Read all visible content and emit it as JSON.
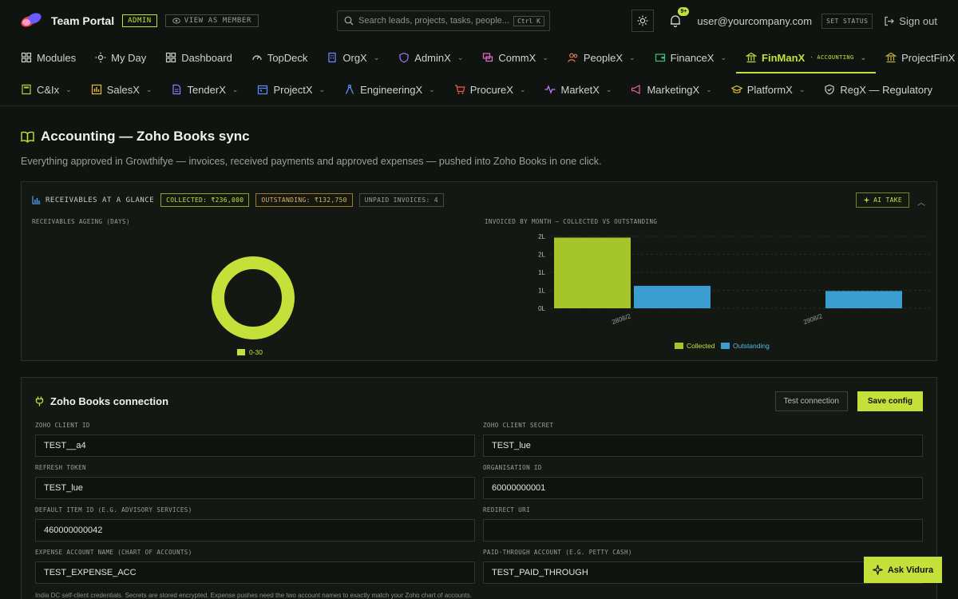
{
  "header": {
    "brand": "Team Portal",
    "admin_badge": "ADMIN",
    "view_as_member": "VIEW AS MEMBER",
    "search_placeholder": "Search leads, projects, tasks, people...",
    "search_shortcut": "Ctrl K",
    "notification_count": "9+",
    "user_email": "user@yourcompany.com",
    "set_status": "SET STATUS",
    "sign_out": "Sign out"
  },
  "nav_row1": [
    {
      "label": "Modules",
      "icon": "grid-icon"
    },
    {
      "label": "My Day",
      "icon": "sun-icon"
    },
    {
      "label": "Dashboard",
      "icon": "grid-icon"
    },
    {
      "label": "TopDeck",
      "icon": "gauge-icon"
    },
    {
      "label": "OrgX",
      "icon": "building-icon"
    },
    {
      "label": "AdminX",
      "icon": "shield-icon"
    },
    {
      "label": "CommX",
      "icon": "chat-icon"
    },
    {
      "label": "PeopleX",
      "icon": "people-icon"
    },
    {
      "label": "FinanceX",
      "icon": "wallet-icon"
    },
    {
      "label": "FinManX",
      "sub": "· ACCOUNTING",
      "icon": "bank-icon"
    },
    {
      "label": "ProjectFinX",
      "icon": "bank-icon"
    }
  ],
  "nav_row2": [
    {
      "label": "C&Ix",
      "icon": "calc-icon"
    },
    {
      "label": "SalesX",
      "icon": "sales-icon"
    },
    {
      "label": "TenderX",
      "icon": "document-icon"
    },
    {
      "label": "ProjectX",
      "icon": "calendar-icon"
    },
    {
      "label": "EngineeringX",
      "icon": "compass-icon"
    },
    {
      "label": "ProcureX",
      "icon": "cart-icon"
    },
    {
      "label": "MarketX",
      "icon": "pulse-icon"
    },
    {
      "label": "MarketingX",
      "icon": "megaphone-icon"
    },
    {
      "label": "PlatformX",
      "icon": "cap-icon"
    },
    {
      "label": "RegX — Regulatory",
      "icon": "shield-icon"
    }
  ],
  "page": {
    "title": "Accounting — Zoho Books sync",
    "subtitle": "Everything approved in Growthifye — invoices, received payments and approved expenses — pushed into Zoho Books in one click."
  },
  "receivables": {
    "title": "RECEIVABLES AT A GLANCE",
    "collected_chip": "COLLECTED: ₹236,000",
    "outstanding_chip": "OUTSTANDING: ₹132,750",
    "unpaid_chip": "UNPAID INVOICES: 4",
    "ai_take": "AI TAKE",
    "ageing_label": "RECEIVABLES AGEING (DAYS)",
    "monthly_label": "INVOICED BY MONTH — COLLECTED VS OUTSTANDING"
  },
  "chart_data": [
    {
      "type": "pie",
      "title": "RECEIVABLES AGEING (DAYS)",
      "slices": [
        {
          "name": "0-30",
          "value": 100,
          "color": "#c6e03a"
        }
      ],
      "legend": "bottom"
    },
    {
      "type": "bar",
      "title": "INVOICED BY MONTH — COLLECTED VS OUTSTANDING",
      "categories": [
        "2808/2",
        "2908/2"
      ],
      "series": [
        {
          "name": "Collected",
          "values": [
            236000,
            0
          ],
          "color": "#a6c52c"
        },
        {
          "name": "Outstanding",
          "values": [
            75000,
            57750
          ],
          "color": "#3a9fd0"
        }
      ],
      "y_ticks": [
        "0L",
        "1L",
        "1L",
        "2L",
        "2L"
      ],
      "ylim": [
        0,
        240000
      ],
      "grid": true,
      "legend": "bottom"
    }
  ],
  "connection": {
    "title": "Zoho Books connection",
    "test_button": "Test connection",
    "save_button": "Save config",
    "fields": [
      {
        "label": "ZOHO CLIENT ID",
        "value": "TEST__a4"
      },
      {
        "label": "ZOHO CLIENT SECRET",
        "value": "TEST_lue"
      },
      {
        "label": "REFRESH TOKEN",
        "value": "TEST_lue"
      },
      {
        "label": "ORGANISATION ID",
        "value": "60000000001"
      },
      {
        "label": "DEFAULT ITEM ID (E.G. ADVISORY SERVICES)",
        "value": "460000000042"
      },
      {
        "label": "REDIRECT URI",
        "value": ""
      },
      {
        "label": "EXPENSE ACCOUNT NAME (CHART OF ACCOUNTS)",
        "value": "TEST_EXPENSE_ACC"
      },
      {
        "label": "PAID-THROUGH ACCOUNT (E.G. PETTY CASH)",
        "value": "TEST_PAID_THROUGH"
      }
    ],
    "note": "India DC self-client credentials. Secrets are stored encrypted. Expense pushes need the two account names to exactly match your Zoho chart of accounts."
  },
  "ask_button": "Ask Vidura",
  "colors": {
    "accent": "#c6e03a",
    "outstanding": "#3a9fd0",
    "bg": "#101411"
  }
}
